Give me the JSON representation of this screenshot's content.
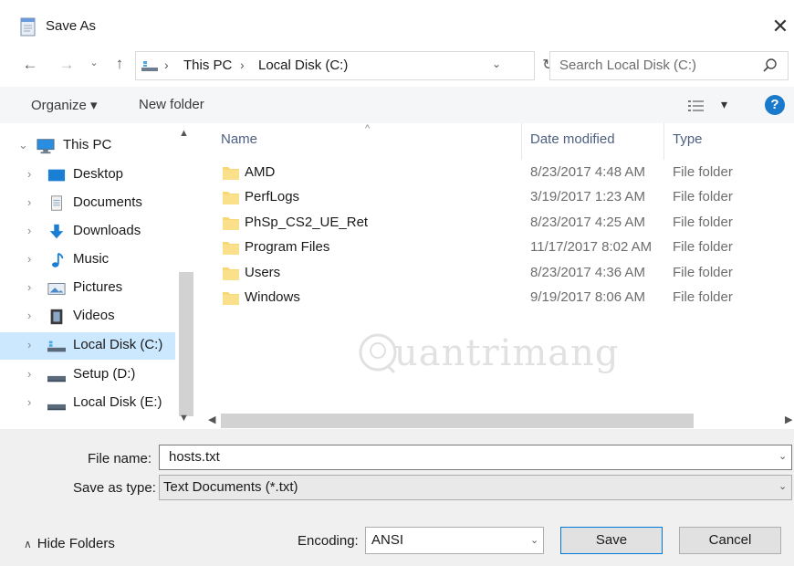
{
  "window": {
    "title": "Save As",
    "close_glyph": "✕"
  },
  "address": {
    "back_glyph": "←",
    "forward_glyph": "→",
    "recent_glyph": "⌄",
    "up_glyph": "↑",
    "separator": "›",
    "crumbs": [
      "This PC",
      "Local Disk (C:)"
    ],
    "dropdown_glyph": "⌄",
    "refresh_glyph": "↻"
  },
  "search": {
    "placeholder": "Search Local Disk (C:)"
  },
  "toolbar": {
    "organize_label": "Organize ▾",
    "new_folder_label": "New folder",
    "view_glyph": "▾",
    "help_glyph": "?"
  },
  "nav": {
    "scroll_up_glyph": "▲",
    "scroll_down_glyph": "▼",
    "items": [
      {
        "label": "This PC",
        "chevron": "⌄",
        "icon": "this-pc-icon",
        "selected": false
      },
      {
        "label": "Desktop",
        "chevron": "›",
        "icon": "desktop-icon",
        "selected": false
      },
      {
        "label": "Documents",
        "chevron": "›",
        "icon": "documents-icon",
        "selected": false
      },
      {
        "label": "Downloads",
        "chevron": "›",
        "icon": "downloads-icon",
        "selected": false
      },
      {
        "label": "Music",
        "chevron": "›",
        "icon": "music-icon",
        "selected": false
      },
      {
        "label": "Pictures",
        "chevron": "›",
        "icon": "pictures-icon",
        "selected": false
      },
      {
        "label": "Videos",
        "chevron": "›",
        "icon": "videos-icon",
        "selected": false
      },
      {
        "label": "Local Disk (C:)",
        "chevron": "›",
        "icon": "local-disk-icon",
        "selected": true
      },
      {
        "label": "Setup (D:)",
        "chevron": "›",
        "icon": "drive-icon",
        "selected": false
      },
      {
        "label": "Local Disk (E:)",
        "chevron": "›",
        "icon": "drive-icon",
        "selected": false
      }
    ]
  },
  "files": {
    "columns": {
      "name": "Name",
      "date": "Date modified",
      "type": "Type"
    },
    "sort_glyph": "^",
    "rows": [
      {
        "name": "AMD",
        "date": "8/23/2017 4:48 AM",
        "type": "File folder"
      },
      {
        "name": "PerfLogs",
        "date": "3/19/2017 1:23 AM",
        "type": "File folder"
      },
      {
        "name": "PhSp_CS2_UE_Ret",
        "date": "8/23/2017 4:25 AM",
        "type": "File folder"
      },
      {
        "name": "Program Files",
        "date": "11/17/2017 8:02 AM",
        "type": "File folder"
      },
      {
        "name": "Users",
        "date": "8/23/2017 4:36 AM",
        "type": "File folder"
      },
      {
        "name": "Windows",
        "date": "9/19/2017 8:06 AM",
        "type": "File folder"
      }
    ],
    "scroll_left_glyph": "◀",
    "scroll_right_glyph": "▶"
  },
  "watermark": {
    "text": "uantrimang"
  },
  "form": {
    "file_name_label": "File name:",
    "file_name_value": "hosts.txt",
    "save_type_label": "Save as type:",
    "save_type_value": "Text Documents (*.txt)",
    "dropdown_glyph": "⌄",
    "hide_folders_label": "Hide Folders",
    "hide_folders_glyph": "∧",
    "encoding_label": "Encoding:",
    "encoding_value": "ANSI",
    "save_label": "Save",
    "cancel_label": "Cancel"
  },
  "colors": {
    "accent": "#0078d7",
    "selection": "#cce8ff",
    "help_blue": "#1979ca",
    "folder_yellow": "#f8d775",
    "header_text": "#4d6082"
  }
}
